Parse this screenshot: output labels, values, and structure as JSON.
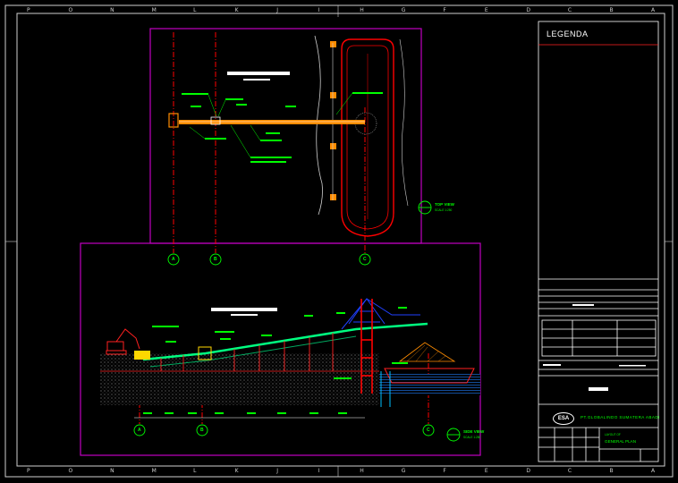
{
  "legend": {
    "title": "LEGENDA"
  },
  "title_block": {
    "logo_text": "ESA",
    "company": "PT.GLOBALINDO SUMATERA ABADI",
    "drawing_subtitle": "LAYOUT OF",
    "drawing_title": "GENERAL PLAN"
  },
  "views": {
    "top_view": {
      "label": "TOP VIEW",
      "scale": "SCALE 1:250"
    },
    "side_view": {
      "label": "SIDE VIEW",
      "scale": "SCALE 1:250"
    }
  },
  "axis_labels": {
    "a": "A",
    "b": "B",
    "c": "C"
  },
  "border": {
    "top_letters": [
      "P",
      "O",
      "N",
      "M",
      "L",
      "K",
      "J",
      "I",
      "H",
      "G",
      "F",
      "E",
      "D",
      "C",
      "B",
      "A"
    ],
    "bottom_letters": [
      "P",
      "O",
      "N",
      "M",
      "L",
      "K",
      "J",
      "I",
      "H",
      "G",
      "F",
      "E",
      "D",
      "C",
      "B",
      "A"
    ],
    "side_marks": [
      "1",
      "2"
    ]
  },
  "colors": {
    "frame": "#cfcfcf",
    "title_block": "#ffffff",
    "viewport": "#c000c0",
    "axis": "#ff0000",
    "conveyor": "#ff8c00",
    "annotation": "#00ff00",
    "truss": "#2040ff",
    "water": "#2080ff"
  }
}
